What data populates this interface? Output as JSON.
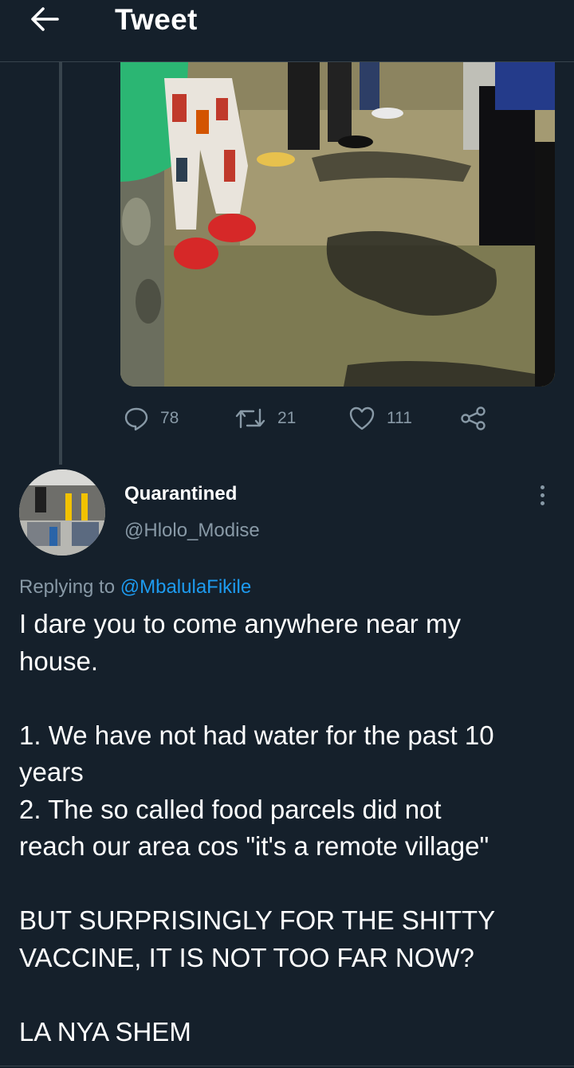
{
  "header": {
    "title": "Tweet",
    "back_icon": "arrow-left-icon"
  },
  "parent_tweet": {
    "media_description_icon": "photo",
    "actions": {
      "replies": "78",
      "retweets": "21",
      "likes": "111"
    }
  },
  "reply": {
    "display_name": "Quarantined",
    "handle": "@Hlolo_Modise",
    "replying_to_prefix": "Replying to ",
    "replying_to_mention": "@MbalulaFikile",
    "text_lines": [
      "I dare you to come anywhere near my",
      "house.",
      "",
      "1. We have not had water for the past 10",
      "years",
      "2. The so called food parcels did not",
      "reach our area cos \"it's a remote village\"",
      "",
      "BUT SURPRISINGLY FOR THE SHITTY",
      "VACCINE, IT IS NOT TOO FAR NOW?",
      "",
      "LA NYA SHEM"
    ]
  },
  "colors": {
    "background": "#15202b",
    "muted_text": "#8899a6",
    "link": "#1d9bf0",
    "divider": "#38444d"
  }
}
